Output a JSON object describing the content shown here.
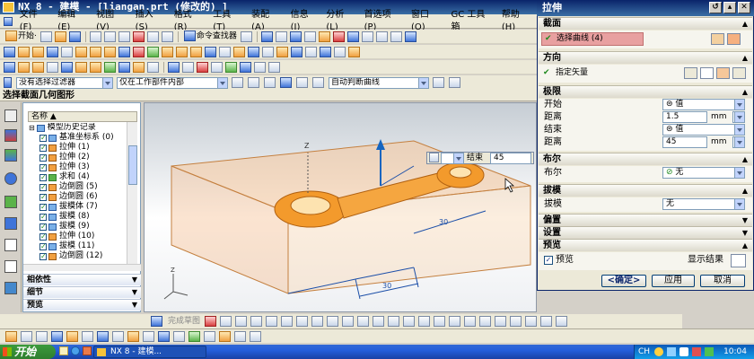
{
  "window": {
    "title": "NX 8 - 建模 - [liangan.prt  (修改的)  ]"
  },
  "menu": [
    "文件(F)",
    "编辑(E)",
    "视图(V)",
    "插入(S)",
    "格式(R)",
    "工具(T)",
    "装配(A)",
    "信息(I)",
    "分析(L)",
    "首选项(P)",
    "窗口(O)",
    "GC 工具箱",
    "帮助(H)"
  ],
  "toolbar": {
    "start_label": "开始·",
    "command_finder_label": "命令查找器"
  },
  "selection_bar": {
    "filter_value": "没有选择过滤器",
    "scope_value": "仅在工作部件内部",
    "curve_rule_value": "自动判断曲线"
  },
  "cue_line": "选择截面几何图形",
  "navigator": {
    "column_header": "名称",
    "tree": [
      "模型历史记录",
      "基准坐标系 (0)",
      "拉伸 (1)",
      "拉伸 (2)",
      "拉伸 (3)",
      "求和 (4)",
      "边倒圆 (5)",
      "边倒圆 (6)",
      "拔模体 (7)",
      "拔模 (8)",
      "拔模 (9)",
      "拉伸 (10)",
      "拔模 (11)",
      "边倒圆 (12)"
    ],
    "sections": [
      "相依性",
      "细节",
      "预览"
    ]
  },
  "onscreen_input": {
    "label": "结束",
    "value": "45"
  },
  "graphics": {
    "dimension_1": "30",
    "dimension_2": "30"
  },
  "dialog": {
    "title": "拉伸",
    "groups": {
      "section": {
        "header": "截面",
        "select_curve": "选择曲线 (4)"
      },
      "direction": {
        "header": "方向",
        "specify_vector": "指定矢量"
      },
      "limits": {
        "header": "极限",
        "start_label": "开始",
        "start_value": "值",
        "start_distance_label": "距离",
        "start_distance": "1.5",
        "end_label": "结束",
        "end_value": "值",
        "end_distance_label": "距离",
        "end_distance": "45",
        "unit": "mm"
      },
      "boolean": {
        "header": "布尔",
        "label": "布尔",
        "value": "无"
      },
      "draft": {
        "header": "拔模",
        "label": "拔模",
        "value": "无"
      },
      "offset": {
        "header": "偏置"
      },
      "settings": {
        "header": "设置"
      },
      "preview": {
        "header": "预览",
        "checkbox_label": "预览",
        "show_result_label": "显示结果"
      }
    },
    "buttons": {
      "ok": "<确定>",
      "apply": "应用",
      "cancel": "取消"
    }
  },
  "bottom_toolbar": {
    "sketch_label": "完成草图"
  },
  "taskbar": {
    "start_label": "开始",
    "task_label": "NX 8 - 建模...",
    "lang": "CH",
    "clock": "10:04"
  },
  "colors": {
    "title_bar": "#0a246a",
    "model_orange": "#f39a2c",
    "block_orange": "#f6c79a",
    "selection_red": "#e8a0a0",
    "dim_blue": "#1c4fa8"
  }
}
